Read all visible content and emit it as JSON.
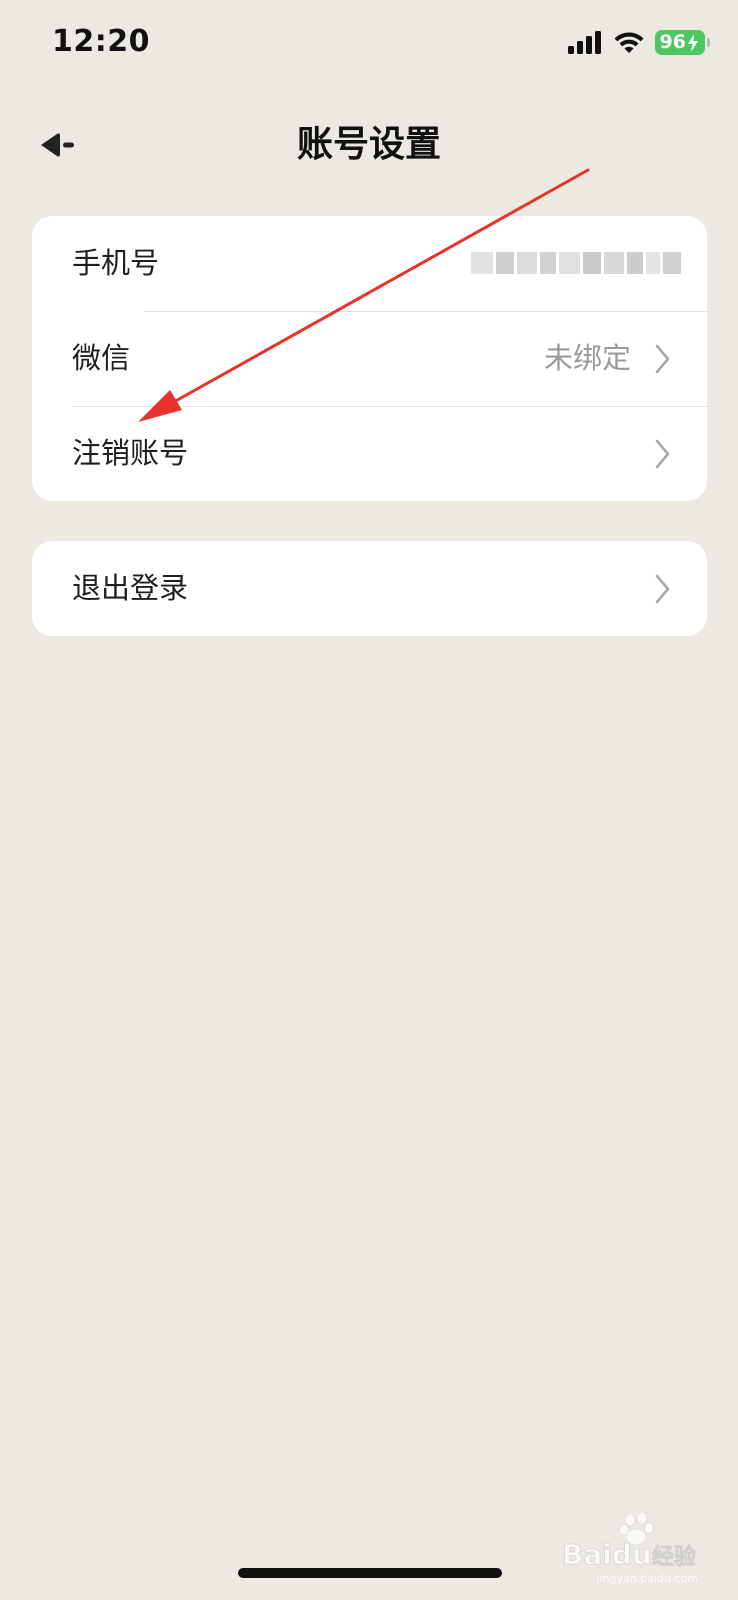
{
  "status_bar": {
    "time": "12:20",
    "battery_level": "96"
  },
  "nav": {
    "title": "账号设置"
  },
  "account_section": {
    "items": [
      {
        "label": "手机号",
        "value": ""
      },
      {
        "label": "微信",
        "value": "未绑定"
      },
      {
        "label": "注销账号",
        "value": ""
      }
    ]
  },
  "logout_section": {
    "label": "退出登录"
  },
  "watermark": {
    "brand": "Baidu",
    "brand_cn": "经验",
    "domain": "jingyan.baidu.com"
  },
  "colors": {
    "background": "#ECE9E2",
    "card": "#FFFFFF",
    "battery": "#4CC763",
    "annotation_arrow": "#E8322B"
  },
  "icons": {
    "back": "back-arrow-icon",
    "chevron": "chevron-right-icon",
    "signal": "cellular-signal-icon",
    "wifi": "wifi-icon",
    "battery": "battery-icon"
  }
}
